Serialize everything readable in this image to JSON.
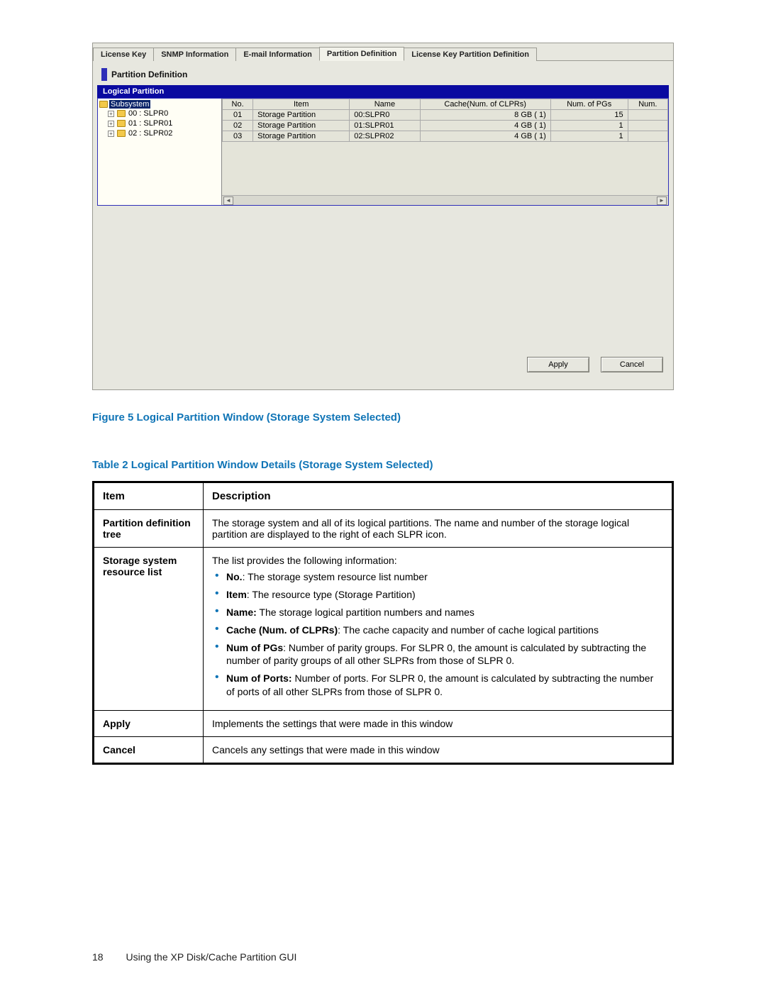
{
  "app": {
    "tabs": [
      {
        "label": "License Key"
      },
      {
        "label": "SNMP Information"
      },
      {
        "label": "E-mail Information"
      },
      {
        "label": "Partition Definition"
      },
      {
        "label": "License Key Partition Definition"
      }
    ],
    "active_tab_index": 3,
    "panel_title": "Partition Definition",
    "section_label": "Logical Partition",
    "tree": {
      "root": "Subsystem",
      "items": [
        {
          "label": "00 : SLPR0"
        },
        {
          "label": "01 : SLPR01"
        },
        {
          "label": "02 : SLPR02"
        }
      ]
    },
    "grid": {
      "headers": [
        "No.",
        "Item",
        "Name",
        "Cache(Num. of CLPRs)",
        "Num. of PGs",
        "Num."
      ],
      "rows": [
        {
          "no": "01",
          "item": "Storage Partition",
          "name": "00:SLPR0",
          "cache": "8 GB ( 1)",
          "pgs": "15",
          "num": ""
        },
        {
          "no": "02",
          "item": "Storage Partition",
          "name": "01:SLPR01",
          "cache": "4 GB ( 1)",
          "pgs": "1",
          "num": ""
        },
        {
          "no": "03",
          "item": "Storage Partition",
          "name": "02:SLPR02",
          "cache": "4 GB ( 1)",
          "pgs": "1",
          "num": ""
        }
      ]
    },
    "buttons": {
      "apply": "Apply",
      "cancel": "Cancel"
    }
  },
  "captions": {
    "figure": "Figure 5 Logical Partition Window (Storage System Selected)",
    "table": "Table 2 Logical Partition Window Details (Storage System Selected)"
  },
  "details_table": {
    "headers": {
      "item": "Item",
      "description": "Description"
    },
    "rows": [
      {
        "item": "Partition definition tree",
        "description": "The storage system and all of its logical partitions. The name and number of the storage logical partition are displayed to the right of each SLPR icon."
      },
      {
        "item": "Storage system resource list",
        "lead": "The list provides the following information:",
        "bullets": [
          {
            "bold": "No.",
            "sep": ": ",
            "text": "The storage system resource list number"
          },
          {
            "bold": "Item",
            "sep": ": ",
            "text": "The resource type (Storage Partition)"
          },
          {
            "bold": "Name:",
            "sep": " ",
            "text": "The storage logical partition numbers and names"
          },
          {
            "bold": "Cache (Num. of CLPRs)",
            "sep": ": ",
            "text": "The cache capacity and number of cache logical partitions"
          },
          {
            "bold": "Num of PGs",
            "sep": ": ",
            "text": "Number of parity groups. For SLPR 0, the amount is calculated by subtracting the number of parity groups of all other SLPRs from those of SLPR 0."
          },
          {
            "bold": "Num of Ports:",
            "sep": " ",
            "text": "Number of ports. For SLPR 0, the amount is calculated by subtracting the number of ports of all other SLPRs from those of SLPR 0."
          }
        ]
      },
      {
        "item": "Apply",
        "description": "Implements the settings that were made in this window"
      },
      {
        "item": "Cancel",
        "description": "Cancels any settings that were made in this window"
      }
    ]
  },
  "footer": {
    "page_number": "18",
    "running_title": "Using the XP Disk/Cache Partition GUI"
  }
}
